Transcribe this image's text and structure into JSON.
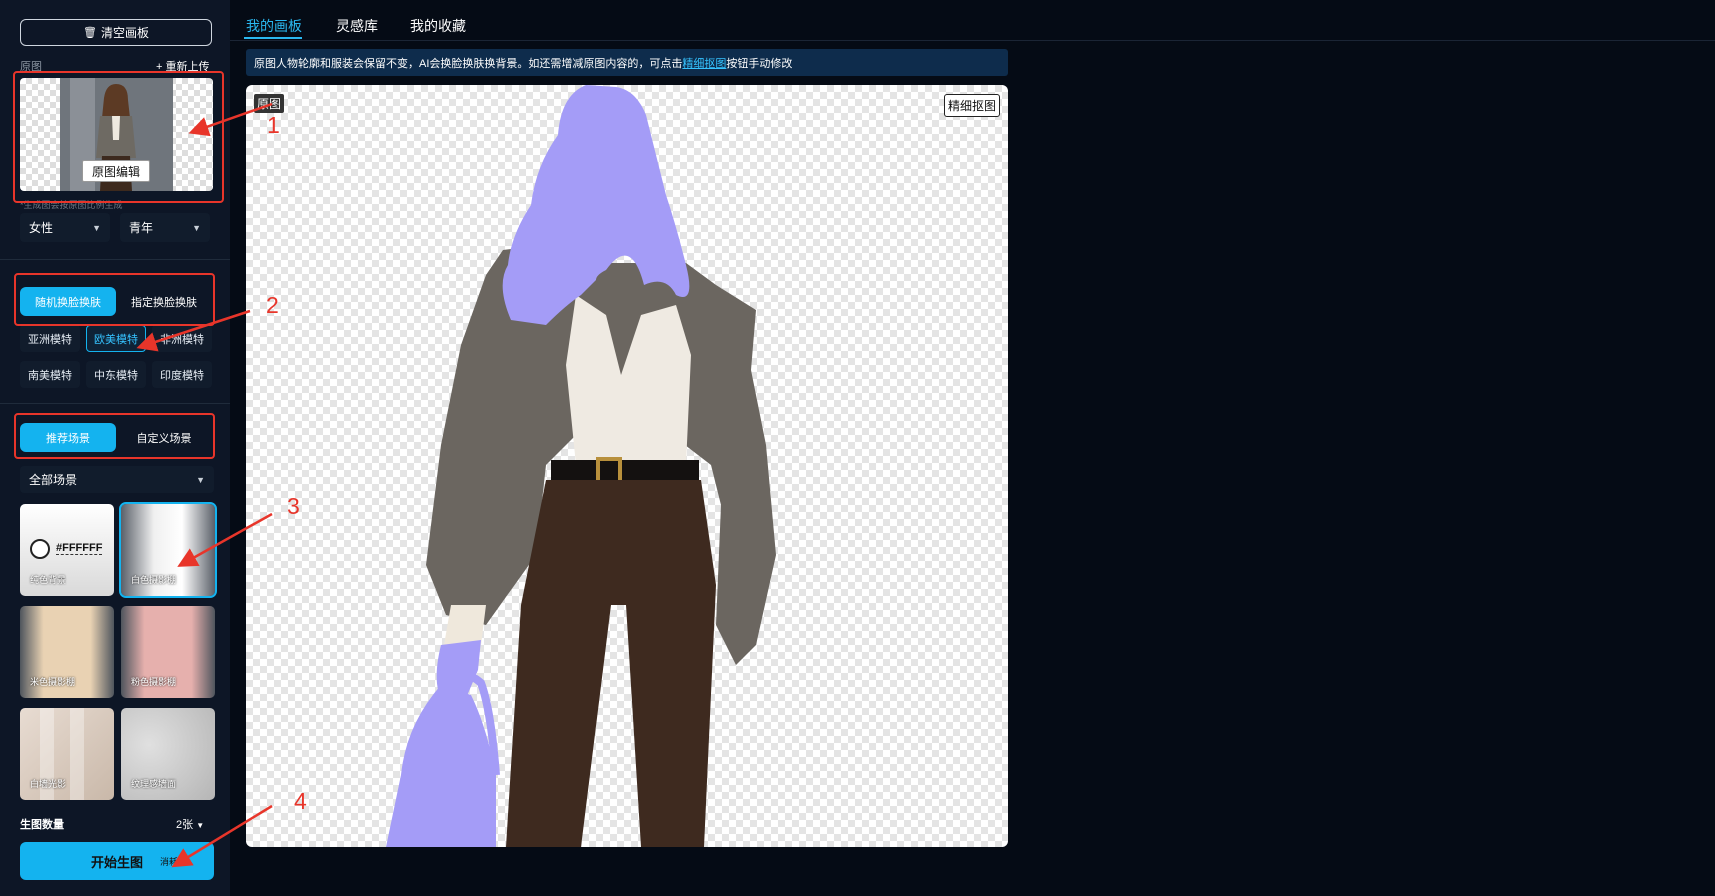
{
  "sidebar": {
    "clear_label": "清空画板",
    "original_label": "原图",
    "reupload_label": "+ 重新上传",
    "original_edit_label": "原图编辑",
    "hint": "*生成图会按原图比例生成",
    "gender": "女性",
    "age": "青年",
    "face_modes": [
      "随机换脸换肤",
      "指定换脸换肤"
    ],
    "model_types": [
      "亚洲模特",
      "欧美模特",
      "非洲模特",
      "南美模特",
      "中东模特",
      "印度模特"
    ],
    "scene_modes": [
      "推荐场景",
      "自定义场景"
    ],
    "scene_filter": "全部场景",
    "scenes": [
      {
        "name": "纯色背景",
        "color": "#FFFFFF"
      },
      {
        "name": "白色摄影棚"
      },
      {
        "name": "米色摄影棚"
      },
      {
        "name": "粉色摄影棚"
      },
      {
        "name": "白墙光影"
      },
      {
        "name": "纹理感墙面"
      }
    ],
    "count_label": "生图数量",
    "count_value": "2张",
    "start_label": "开始生图",
    "start_cost": "消耗"
  },
  "tabs": [
    "我的画板",
    "灵感库",
    "我的收藏"
  ],
  "notice": {
    "text": "原图人物轮廓和服装会保留不变，AI会换脸换肤换背景。如还需增减原图内容的，可点击",
    "link": "精细抠图",
    "suffix": "按钮手动修改"
  },
  "canvas": {
    "tag": "原图",
    "refine_label": "精细抠图",
    "mask_color": "#a49cf7"
  },
  "annotations": [
    "1",
    "2",
    "3",
    "4"
  ],
  "colors": {
    "accent": "#14b3ef",
    "annotation": "#e8352a"
  }
}
